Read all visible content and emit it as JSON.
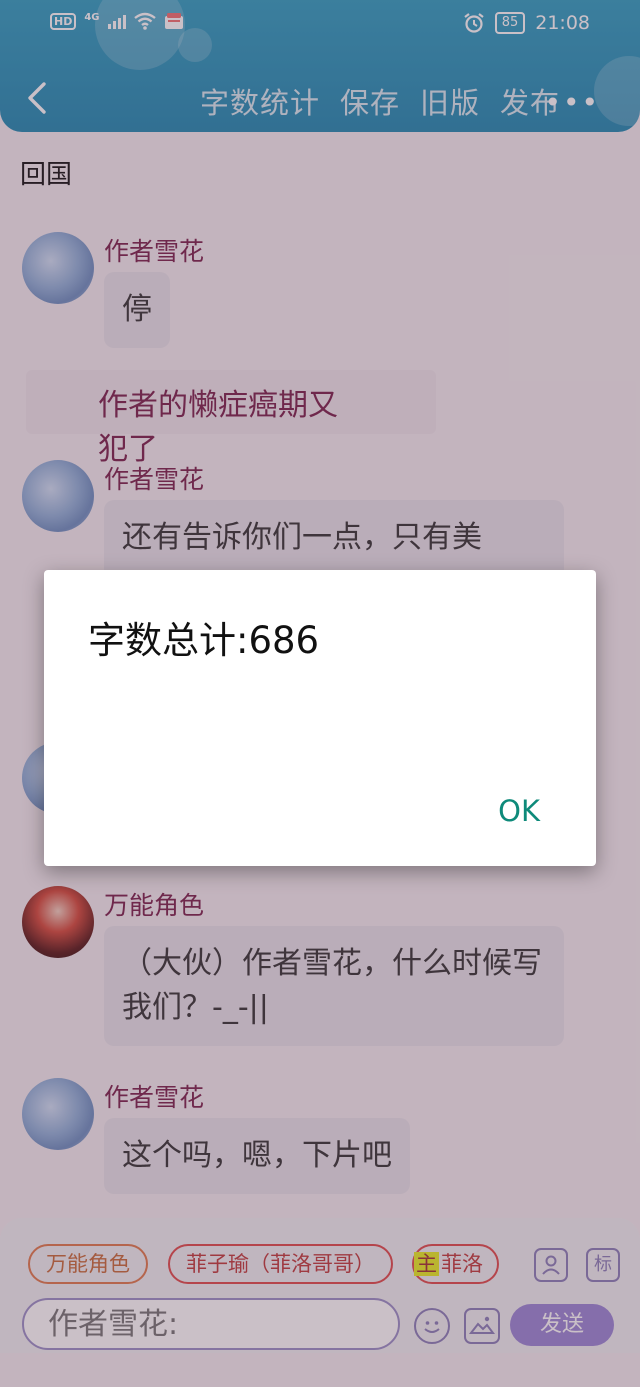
{
  "status_bar": {
    "left_badge": "HD",
    "network": "4G",
    "battery": "85",
    "time": "21:08"
  },
  "toolbar": {
    "actions": [
      "字数统计",
      "保存",
      "旧版",
      "发布"
    ],
    "more_label": "•••"
  },
  "chat": {
    "scene_title": "回国",
    "messages": [
      {
        "type": "dialogue",
        "speaker": "作者雪花",
        "text": "停"
      },
      {
        "type": "narration",
        "text": "作者的懒症癌期又犯了"
      },
      {
        "type": "dialogue",
        "speaker": "作者雪花",
        "text": "还有告诉你们一点，只有美"
      },
      {
        "type": "dialogue",
        "speaker": "万能角色",
        "text": "（大伙）作者雪花，什么时候写我们？-_-||"
      },
      {
        "type": "dialogue",
        "speaker": "作者雪花",
        "text": "这个吗，嗯，下片吧"
      }
    ]
  },
  "input_bar": {
    "character_chips": [
      "万能角色",
      "菲子瑜（菲洛哥哥）"
    ],
    "main_chip": {
      "tag": "主",
      "name": "菲洛"
    },
    "tool_buttons": [
      "person-icon",
      "标"
    ],
    "placeholder": "作者雪花:",
    "send_label": "发送"
  },
  "dialog": {
    "message": "字数总计:686",
    "ok_label": "OK"
  }
}
